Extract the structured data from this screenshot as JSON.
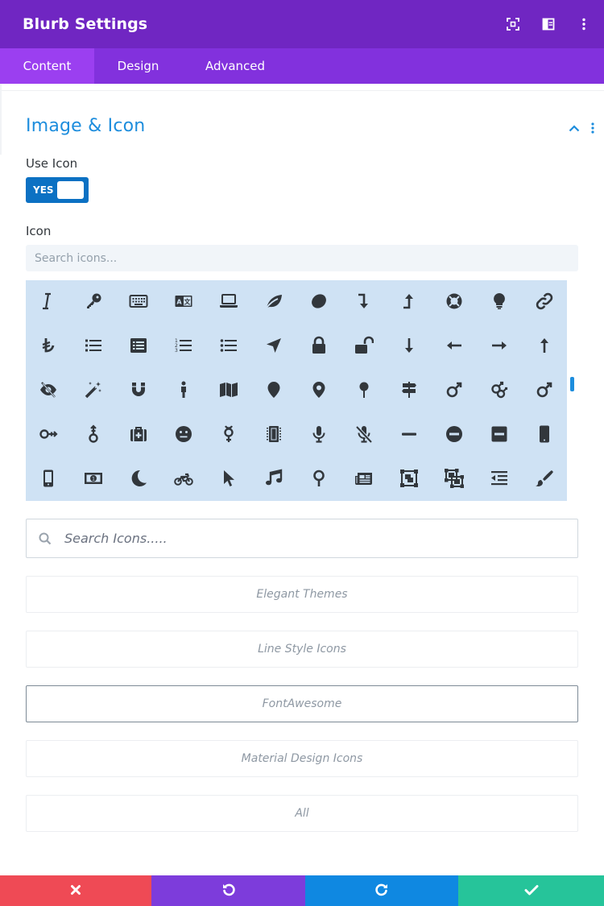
{
  "header": {
    "title": "Blurb Settings"
  },
  "tabs": [
    {
      "label": "Content",
      "active": true
    },
    {
      "label": "Design",
      "active": false
    },
    {
      "label": "Advanced",
      "active": false
    }
  ],
  "section": {
    "title": "Image & Icon"
  },
  "use_icon": {
    "label": "Use Icon",
    "toggle_text": "YES",
    "value": true
  },
  "icon_field": {
    "label": "Icon",
    "search_placeholder": "Search icons..."
  },
  "icon_grid": {
    "selected": null,
    "rows": [
      [
        "italic-icon",
        "key-icon",
        "keyboard-icon",
        "language-icon",
        "laptop-icon",
        "leaf-icon",
        "lemon-icon",
        "level-down-icon",
        "level-up-icon",
        "life-ring-icon",
        "lightbulb-icon",
        "link-icon"
      ],
      [
        "lira-sign-icon",
        "list-icon",
        "list-alt-icon",
        "list-ol-icon",
        "list-ul-icon",
        "location-arrow-icon",
        "lock-icon",
        "lock-open-icon",
        "long-arrow-down-icon",
        "long-arrow-left-icon",
        "long-arrow-right-icon",
        "long-arrow-up-icon"
      ],
      [
        "low-vision-icon",
        "magic-icon",
        "magnet-icon",
        "male-icon",
        "map-icon",
        "map-marker-icon",
        "map-marker-alt-icon",
        "map-pin-icon",
        "map-signs-icon",
        "mars-icon",
        "mars-double-icon",
        "mars-stroke-icon"
      ],
      [
        "mars-stroke-h-icon",
        "mars-stroke-v-icon",
        "medkit-icon",
        "meh-icon",
        "mercury-icon",
        "microchip-icon",
        "microphone-icon",
        "microphone-slash-icon",
        "minus-icon",
        "minus-circle-icon",
        "minus-square-icon",
        "mobile-icon"
      ],
      [
        "mobile-alt-icon",
        "money-bill-icon",
        "moon-icon",
        "motorcycle-icon",
        "mouse-pointer-icon",
        "music-icon",
        "neuter-icon",
        "newspaper-icon",
        "object-group-icon",
        "object-ungroup-icon",
        "outdent-icon",
        "paint-brush-icon"
      ]
    ]
  },
  "icon_search": {
    "placeholder": "Search Icons....."
  },
  "filters": [
    {
      "label": "Elegant Themes",
      "active": false
    },
    {
      "label": "Line Style Icons",
      "active": false
    },
    {
      "label": "FontAwesome",
      "active": true
    },
    {
      "label": "Material Design Icons",
      "active": false
    },
    {
      "label": "All",
      "active": false
    }
  ],
  "footer": {
    "buttons": [
      {
        "icon": "close-icon",
        "color": "#ef4a55"
      },
      {
        "icon": "undo-icon",
        "color": "#7d3cdb"
      },
      {
        "icon": "redo-icon",
        "color": "#0f88e1"
      },
      {
        "icon": "check-icon",
        "color": "#26c49a"
      }
    ]
  },
  "colors": {
    "header": "#7026c2",
    "tabs": "#8231dd",
    "tab_active": "#9b3ff0",
    "accent": "#1d8ddd",
    "toggle": "#0c71c3",
    "grid_bg": "#cfe2f4",
    "icon": "#32373c"
  }
}
